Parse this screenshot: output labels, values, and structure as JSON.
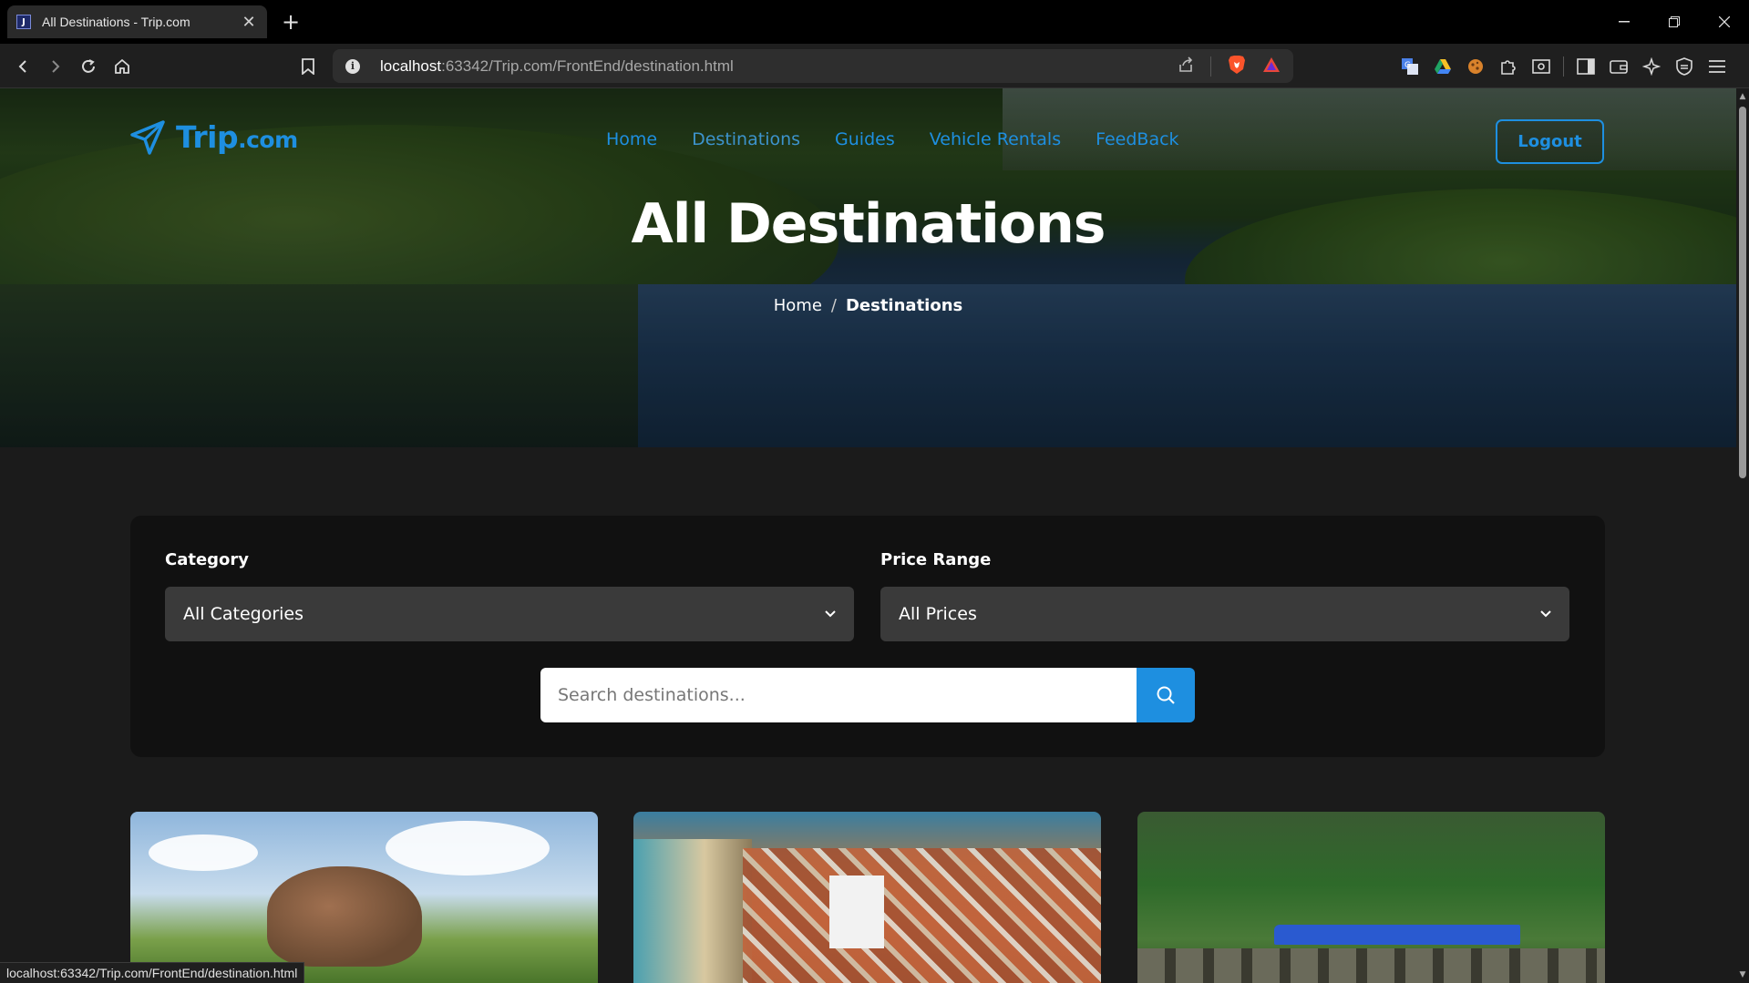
{
  "browser": {
    "tab_title": "All Destinations - Trip.com",
    "tab_close": "✕",
    "new_tab": "+",
    "url_host": "localhost",
    "url_path": ":63342/Trip.com/FrontEnd/destination.html",
    "status_url": "localhost:63342/Trip.com/FrontEnd/destination.html"
  },
  "site": {
    "logo_name": "Trip",
    "logo_suffix": ".com",
    "nav": [
      {
        "label": "Home"
      },
      {
        "label": "Destinations",
        "active": true
      },
      {
        "label": "Guides"
      },
      {
        "label": "Vehicle Rentals"
      },
      {
        "label": "FeedBack"
      }
    ],
    "logout_label": "Logout",
    "accent_color": "#1e8fe0"
  },
  "hero": {
    "title": "All Destinations",
    "breadcrumb_home": "Home",
    "breadcrumb_sep": "/",
    "breadcrumb_current": "Destinations"
  },
  "filters": {
    "category_label": "Category",
    "category_value": "All Categories",
    "price_label": "Price Range",
    "price_value": "All Prices",
    "search_placeholder": "Search destinations...",
    "search_icon": "search-icon"
  }
}
